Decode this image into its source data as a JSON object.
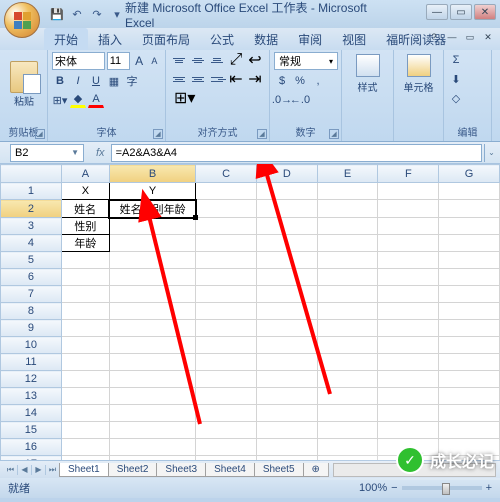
{
  "titlebar": {
    "title": "新建 Microsoft Office Excel 工作表 - Microsoft Excel"
  },
  "tabs": {
    "items": [
      "开始",
      "插入",
      "页面布局",
      "公式",
      "数据",
      "审阅",
      "视图",
      "福昕阅读器"
    ],
    "active_index": 0
  },
  "ribbon": {
    "clipboard": {
      "paste": "粘贴",
      "label": "剪贴板"
    },
    "font": {
      "name": "宋体",
      "size": "11",
      "label": "字体",
      "grow": "A",
      "shrink": "A"
    },
    "alignment": {
      "label": "对齐方式"
    },
    "number": {
      "format": "常规",
      "label": "数字"
    },
    "styles": {
      "btn": "样式",
      "label": ""
    },
    "cells": {
      "btn": "单元格",
      "label": ""
    },
    "editing": {
      "sigma": "Σ",
      "label": "编辑"
    }
  },
  "formula": {
    "namebox": "B2",
    "fx": "fx",
    "content": "=A2&A3&A4"
  },
  "grid": {
    "columns": [
      "A",
      "B",
      "C",
      "D",
      "E",
      "F",
      "G"
    ],
    "rows": 17,
    "data": {
      "A1": "X",
      "B1": "Y",
      "A2": "姓名",
      "B2": "姓名性别年龄",
      "A3": "性别",
      "A4": "年龄"
    },
    "active_cell": "B2"
  },
  "sheets": {
    "items": [
      "Sheet1",
      "Sheet2",
      "Sheet3",
      "Sheet4",
      "Sheet5"
    ],
    "active_index": 0
  },
  "statusbar": {
    "status": "就绪",
    "zoom": "100%"
  },
  "watermark": {
    "brand": "成长必记",
    "bg": "Bai"
  }
}
